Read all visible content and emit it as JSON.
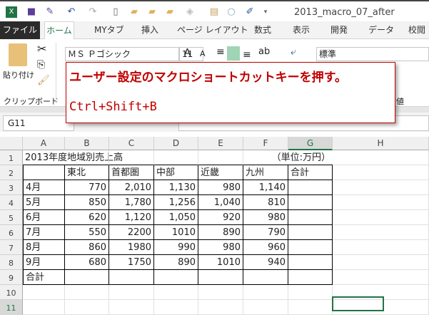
{
  "window": {
    "title": "2013_macro_07_after"
  },
  "tabs": [
    "ファイル",
    "ホーム",
    "MYタブ",
    "挿入",
    "ページ レイアウト",
    "数式",
    "表示",
    "開発",
    "データ",
    "校閲"
  ],
  "ribbon": {
    "paste": "貼り付け",
    "clipboard_group": "クリップボード",
    "font_name": "ＭＳ Ｐゴシック",
    "font_size": "11",
    "number_format": "標準",
    "number_group_partial": "値"
  },
  "name_box": "G11",
  "callout": {
    "line1": "ユーザー設定のマクロショートカットキーを押す。",
    "line2": "Ctrl+Shift+B"
  },
  "sheet": {
    "columns": [
      "A",
      "B",
      "C",
      "D",
      "E",
      "F",
      "G",
      "H"
    ],
    "rows": [
      "1",
      "2",
      "3",
      "4",
      "5",
      "6",
      "7",
      "8",
      "9",
      "10",
      "11"
    ],
    "title": "2013年度地域別売上高",
    "unit": "（単位:万円）",
    "headers": [
      "東北",
      "首都圏",
      "中部",
      "近畿",
      "九州",
      "合計"
    ],
    "data": [
      [
        "4月",
        "770",
        "2,010",
        "1,130",
        "980",
        "1,140"
      ],
      [
        "5月",
        "850",
        "1,780",
        "1,256",
        "1,040",
        "810"
      ],
      [
        "6月",
        "620",
        "1,120",
        "1,050",
        "920",
        "980"
      ],
      [
        "7月",
        "550",
        "2200",
        "1010",
        "890",
        "790"
      ],
      [
        "8月",
        "860",
        "1980",
        "990",
        "980",
        "960"
      ],
      [
        "9月",
        "680",
        "1750",
        "890",
        "1010",
        "940"
      ]
    ],
    "total_label": "合計"
  },
  "colors": {
    "accent": "#217346",
    "callout": "#c00000"
  }
}
